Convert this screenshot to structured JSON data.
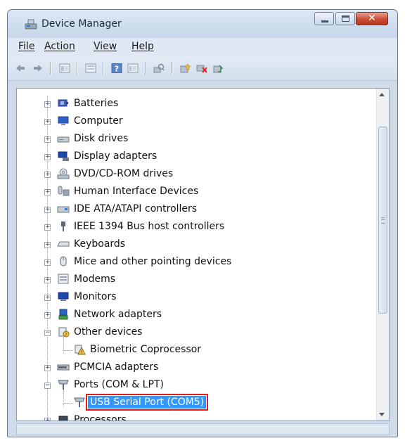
{
  "window": {
    "title": "Device Manager",
    "accent_close": "#c94d33",
    "selection_color": "#3399ff",
    "highlight_box_color": "#e21b1b"
  },
  "menu": [
    {
      "label": "File"
    },
    {
      "label": "Action"
    },
    {
      "label": "View"
    },
    {
      "label": "Help"
    }
  ],
  "toolbar": {
    "icons": [
      "back-arrow-icon",
      "forward-arrow-icon",
      "properties-icon",
      "show-hide-console-tree-icon",
      "help-icon",
      "details-pane-icon",
      "scan-hardware-icon",
      "update-driver-icon",
      "disable-device-icon",
      "uninstall-device-icon"
    ]
  },
  "tree": {
    "items": [
      {
        "label": "Batteries",
        "icon": "battery-icon"
      },
      {
        "label": "Computer",
        "icon": "computer-icon"
      },
      {
        "label": "Disk drives",
        "icon": "disk-drive-icon"
      },
      {
        "label": "Display adapters",
        "icon": "display-adapter-icon"
      },
      {
        "label": "DVD/CD-ROM drives",
        "icon": "dvd-drive-icon"
      },
      {
        "label": "Human Interface Devices",
        "icon": "hid-icon"
      },
      {
        "label": "IDE ATA/ATAPI controllers",
        "icon": "ide-controller-icon"
      },
      {
        "label": "IEEE 1394 Bus host controllers",
        "icon": "ieee1394-icon"
      },
      {
        "label": "Keyboards",
        "icon": "keyboard-icon"
      },
      {
        "label": "Mice and other pointing devices",
        "icon": "mouse-icon"
      },
      {
        "label": "Modems",
        "icon": "modem-icon"
      },
      {
        "label": "Monitors",
        "icon": "monitor-icon"
      },
      {
        "label": "Network adapters",
        "icon": "network-adapter-icon"
      },
      {
        "label": "Other devices",
        "icon": "unknown-device-icon"
      },
      {
        "label": "Biometric Coprocessor",
        "icon": "warning-device-icon"
      },
      {
        "label": "PCMCIA adapters",
        "icon": "pcmcia-icon"
      },
      {
        "label": "Ports (COM & LPT)",
        "icon": "port-icon"
      },
      {
        "label": "USB Serial Port (COM5)",
        "icon": "port-icon"
      },
      {
        "label": "Processors",
        "icon": "processor-icon"
      }
    ]
  }
}
